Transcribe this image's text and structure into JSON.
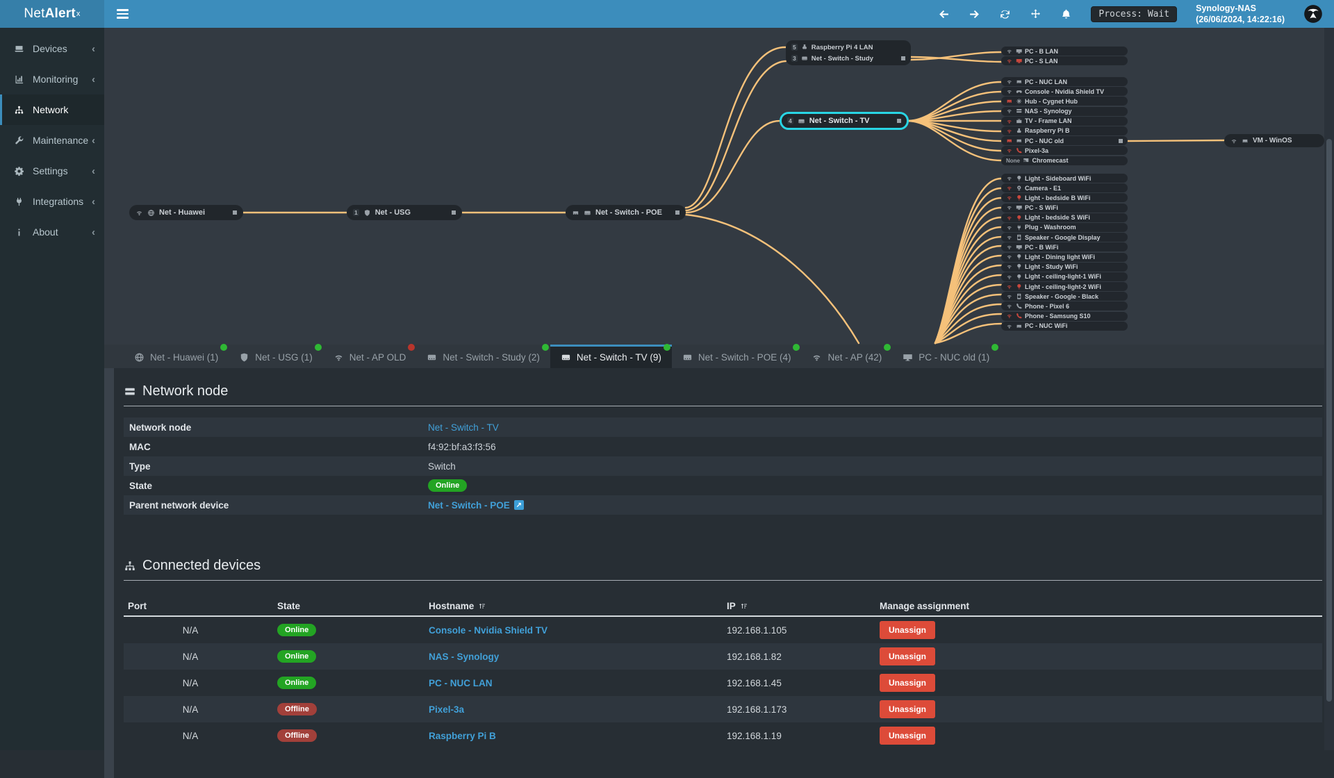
{
  "topbar": {
    "logo": {
      "light": "Net",
      "bold": "Alert",
      "sup": "x"
    },
    "icons": [
      {
        "icon": "arrow-left"
      },
      {
        "icon": "arrow-right"
      },
      {
        "icon": "refresh"
      },
      {
        "icon": "move"
      },
      {
        "icon": "bell"
      }
    ],
    "process_label": "Process: Wait",
    "host": "Synology-NAS",
    "timestamp": "(26/06/2024, 14:22:16)"
  },
  "sidebar": {
    "items": [
      {
        "label": "Devices",
        "icon": "laptop",
        "chevron": true,
        "status": "idle"
      },
      {
        "label": "Monitoring",
        "icon": "chart",
        "chevron": true,
        "status": "idle"
      },
      {
        "label": "Network",
        "icon": "sitemap",
        "chevron": false,
        "status": "active"
      },
      {
        "label": "Maintenance",
        "icon": "wrench",
        "chevron": true,
        "status": "idle"
      },
      {
        "label": "Settings",
        "icon": "gear",
        "chevron": true,
        "status": "idle"
      },
      {
        "label": "Integrations",
        "icon": "plug",
        "chevron": true,
        "status": "idle"
      },
      {
        "label": "About",
        "icon": "info",
        "chevron": true,
        "status": "idle"
      }
    ]
  },
  "diagram": {
    "nodes": {
      "huawei": {
        "label": "Net - Huawei"
      },
      "usg": {
        "label": "Net - USG",
        "badge": "1"
      },
      "poe": {
        "label": "Net - Switch - POE"
      },
      "tv": {
        "label": "Net - Switch - TV",
        "badge": "4"
      },
      "vm": {
        "label": "VM - WinOS"
      }
    },
    "cluster": [
      {
        "label": "Raspberry Pi 4 LAN",
        "badge": "5",
        "icon": "raspberry",
        "port": false
      },
      {
        "label": "Net - Switch - Study",
        "badge": "3",
        "icon": "switch",
        "port": true
      }
    ],
    "block_a": [
      {
        "label": "PC - B LAN",
        "conn": "wifi",
        "cs": "on",
        "dev": "desktop",
        "ds": "on",
        "port": false
      },
      {
        "label": "PC - S LAN",
        "conn": "wifi",
        "cs": "off",
        "dev": "desktop",
        "ds": "off",
        "port": false
      }
    ],
    "block_b": [
      {
        "label": "PC - NUC LAN",
        "conn": "wifi",
        "cs": "on",
        "dev": "eth",
        "ds": "on",
        "port": false
      },
      {
        "label": "Console - Nvidia Shield TV",
        "conn": "wifi",
        "cs": "on",
        "dev": "gamepad",
        "ds": "on",
        "port": false
      },
      {
        "label": "Hub - Cygnet Hub",
        "conn": "eth",
        "cs": "off",
        "dev": "hub",
        "ds": "on",
        "port": false
      },
      {
        "label": "NAS - Synology",
        "conn": "wifi",
        "cs": "on",
        "dev": "server",
        "ds": "on",
        "port": false
      },
      {
        "label": "TV - Frame LAN",
        "conn": "wifi",
        "cs": "off",
        "dev": "tv",
        "ds": "on",
        "port": false
      },
      {
        "label": "Raspberry Pi B",
        "conn": "wifi",
        "cs": "off",
        "dev": "raspberry",
        "ds": "on",
        "port": false
      },
      {
        "label": "PC - NUC old",
        "conn": "eth",
        "cs": "off",
        "dev": "eth",
        "ds": "on",
        "port": true
      },
      {
        "label": "Pixel-3a",
        "conn": "wifi",
        "cs": "off",
        "dev": "phone",
        "ds": "off",
        "port": false
      },
      {
        "label": "Chromecast",
        "conn": "none",
        "conn_text": "None",
        "cs": "on",
        "dev": "cast",
        "ds": "on",
        "port": false
      }
    ],
    "block_c": [
      {
        "label": "Light - Sideboard WiFi",
        "conn": "wifi",
        "cs": "on",
        "dev": "bulb",
        "ds": "on",
        "port": false
      },
      {
        "label": "Camera - E1",
        "conn": "wifi",
        "cs": "off",
        "dev": "camera",
        "ds": "on",
        "port": false
      },
      {
        "label": "Light - bedside B WiFi",
        "conn": "wifi",
        "cs": "off",
        "dev": "bulb",
        "ds": "off",
        "port": false
      },
      {
        "label": "PC - S WiFi",
        "conn": "wifi",
        "cs": "on",
        "dev": "desktop",
        "ds": "on",
        "port": false
      },
      {
        "label": "Light - bedside S WiFi",
        "conn": "wifi",
        "cs": "off",
        "dev": "bulb",
        "ds": "off",
        "port": false
      },
      {
        "label": "Plug - Washroom",
        "conn": "wifi",
        "cs": "on",
        "dev": "plug",
        "ds": "on",
        "port": false
      },
      {
        "label": "Speaker - Google Display",
        "conn": "wifi",
        "cs": "on",
        "dev": "speaker",
        "ds": "on",
        "port": false
      },
      {
        "label": "PC - B WiFi",
        "conn": "wifi",
        "cs": "on",
        "dev": "desktop",
        "ds": "on",
        "port": false
      },
      {
        "label": "Light - Dining light WiFi",
        "conn": "wifi",
        "cs": "on",
        "dev": "bulb",
        "ds": "on",
        "port": false
      },
      {
        "label": "Light - Study WiFi",
        "conn": "wifi",
        "cs": "on",
        "dev": "bulb",
        "ds": "on",
        "port": false
      },
      {
        "label": "Light - ceiling-light-1 WiFi",
        "conn": "wifi",
        "cs": "on",
        "dev": "bulb",
        "ds": "on",
        "port": false
      },
      {
        "label": "Light - ceiling-light-2 WiFi",
        "conn": "wifi",
        "cs": "off",
        "dev": "bulb",
        "ds": "off",
        "port": false
      },
      {
        "label": "Speaker - Google - Black",
        "conn": "wifi",
        "cs": "on",
        "dev": "speaker",
        "ds": "on",
        "port": false
      },
      {
        "label": "Phone - Pixel 6",
        "conn": "wifi",
        "cs": "on",
        "dev": "phone",
        "ds": "on",
        "port": false
      },
      {
        "label": "Phone - Samsung S10",
        "conn": "wifi",
        "cs": "off",
        "dev": "phone",
        "ds": "off",
        "port": false
      },
      {
        "label": "PC - NUC WiFi",
        "conn": "wifi",
        "cs": "on",
        "dev": "eth",
        "ds": "on",
        "port": false
      }
    ]
  },
  "tabs": [
    {
      "icon": "globe",
      "label": "Net - Huawei (1)",
      "dot": "green",
      "status": "idle"
    },
    {
      "icon": "shield",
      "label": "Net - USG (1)",
      "dot": "green",
      "status": "idle"
    },
    {
      "icon": "wifi",
      "label": "Net - AP OLD",
      "dot": "red",
      "status": "idle"
    },
    {
      "icon": "switch",
      "label": "Net - Switch - Study (2)",
      "dot": "green",
      "status": "idle"
    },
    {
      "icon": "switch",
      "label": "Net - Switch - TV (9)",
      "dot": "green",
      "status": "active"
    },
    {
      "icon": "switch",
      "label": "Net - Switch - POE (4)",
      "dot": "green",
      "status": "idle"
    },
    {
      "icon": "wifi",
      "label": "Net - AP (42)",
      "dot": "green",
      "status": "idle"
    },
    {
      "icon": "desktop",
      "label": "PC - NUC old (1)",
      "dot": "green",
      "status": "idle"
    }
  ],
  "node_section": {
    "title": "Network node",
    "rows": [
      {
        "label": "Network node",
        "type": "link",
        "value": "Net - Switch - TV"
      },
      {
        "label": "MAC",
        "type": "text",
        "value": "f4:92:bf:a3:f3:56"
      },
      {
        "label": "Type",
        "type": "text",
        "value": "Switch"
      },
      {
        "label": "State",
        "type": "badge",
        "value": "Online"
      },
      {
        "label": "Parent network device",
        "type": "linkext",
        "value": "Net - Switch - POE"
      }
    ],
    "extlink_glyph": "↗"
  },
  "devices_section": {
    "title": "Connected devices",
    "columns": {
      "port": "Port",
      "state": "State",
      "hostname": "Hostname",
      "ip": "IP",
      "manage": "Manage assignment"
    },
    "rows": [
      {
        "port": "N/A",
        "state": "Online",
        "hostname": "Console - Nvidia Shield TV",
        "ip": "192.168.1.105",
        "action": "Unassign"
      },
      {
        "port": "N/A",
        "state": "Online",
        "hostname": "NAS - Synology",
        "ip": "192.168.1.82",
        "action": "Unassign"
      },
      {
        "port": "N/A",
        "state": "Online",
        "hostname": "PC - NUC LAN",
        "ip": "192.168.1.45",
        "action": "Unassign"
      },
      {
        "port": "N/A",
        "state": "Offline",
        "hostname": "Pixel-3a",
        "ip": "192.168.1.173",
        "action": "Unassign"
      },
      {
        "port": "N/A",
        "state": "Offline",
        "hostname": "Raspberry Pi B",
        "ip": "192.168.1.19",
        "action": "Unassign"
      }
    ]
  },
  "colors": {
    "accent": "#3c8dbc",
    "line": "#f5c17a",
    "selected": "#29d5e4",
    "online": "#23a423",
    "offline": "#a2403a",
    "danger": "#dd4b39",
    "link": "#41a0d8",
    "dot_green": "#2fb834",
    "dot_red": "#b8352c"
  }
}
